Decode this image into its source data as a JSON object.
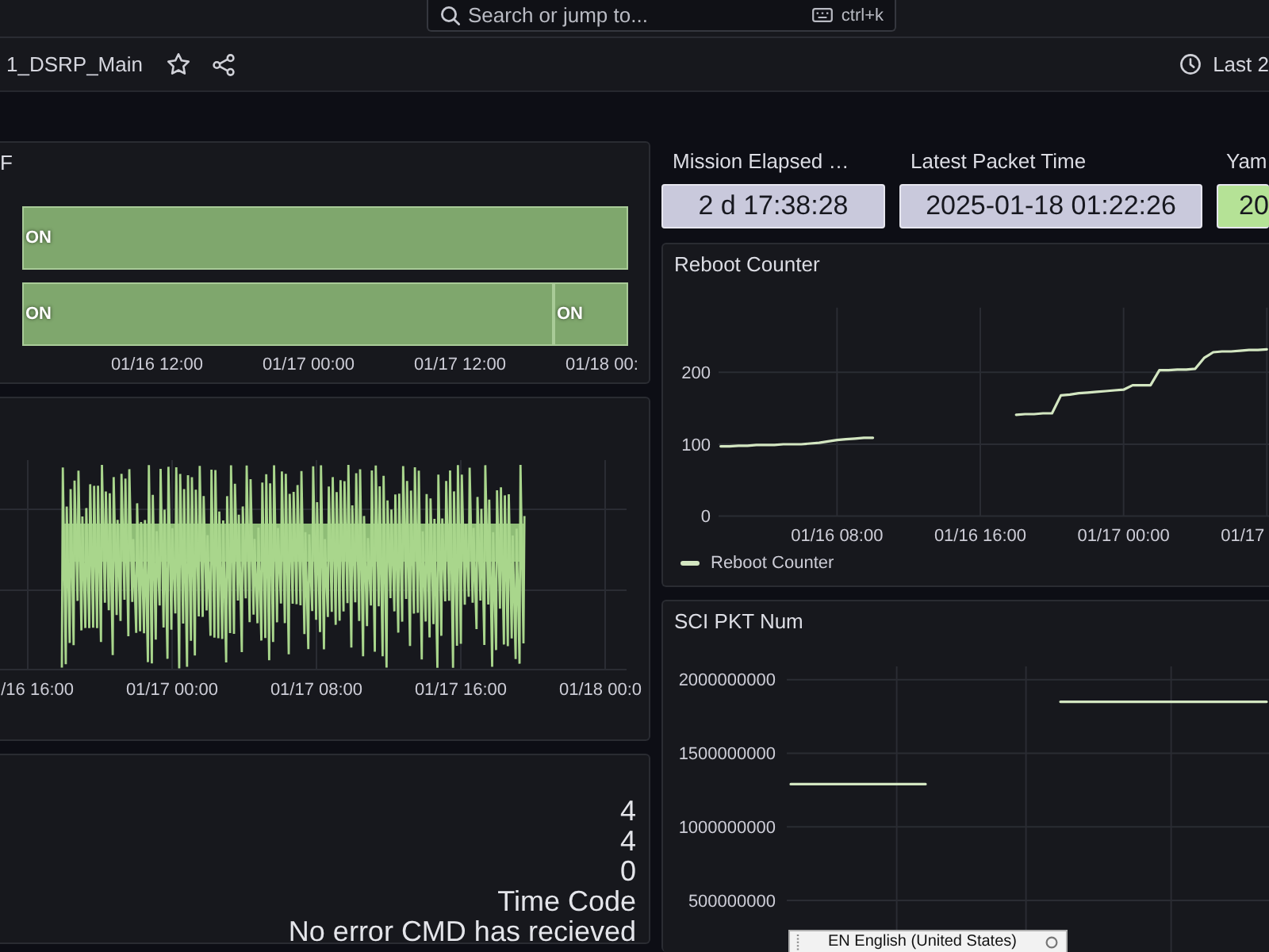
{
  "search": {
    "placeholder": "Search or jump to...",
    "shortcut": "ctrl+k"
  },
  "dashboard": {
    "title": "1_DSRP_Main",
    "starred": false,
    "time_range": "Last 2"
  },
  "state_panel": {
    "title": "F",
    "rows": [
      {
        "segments": [
          {
            "label": "ON"
          }
        ]
      },
      {
        "segments": [
          {
            "label": "ON"
          },
          {
            "label": "ON"
          }
        ],
        "level": 0.877
      }
    ],
    "x_labels": [
      "01/16 12:00",
      "01/17 00:00",
      "01/17 12:00",
      "01/18 00:"
    ]
  },
  "wave_panel": {
    "x_labels": [
      "/16 16:00",
      "01/17 00:00",
      "01/17 08:00",
      "01/17 16:00",
      "01/18 00:0"
    ]
  },
  "text_panel": {
    "lines": [
      "4",
      "4",
      "0",
      "Time Code",
      "No error CMD has recieved"
    ]
  },
  "stats": [
    {
      "title": "Mission Elapsed …",
      "value": "2 d 17:38:28",
      "color": "#c9c9dc"
    },
    {
      "title": "Latest Packet Time",
      "value": "2025-01-18 01:22:26",
      "color": "#c9c9dc"
    },
    {
      "title": "Yam",
      "value": "20",
      "color": "#b5e296"
    }
  ],
  "reboot_panel": {
    "title": "Reboot Counter",
    "legend": true,
    "partial_x_label": "01/17",
    "chart_data": {
      "type": "line",
      "grid": true,
      "categories": [
        null,
        null,
        null,
        null,
        null,
        null,
        null,
        null,
        null,
        null,
        null,
        null,
        null,
        "01/16 08:00",
        null,
        null,
        null,
        null,
        null,
        null,
        null,
        null,
        null,
        null,
        null,
        null,
        null,
        null,
        null,
        "01/16 16:00",
        null,
        null,
        null,
        null,
        null,
        null,
        null,
        null,
        null,
        null,
        null,
        null,
        null,
        null,
        null,
        "01/17 00:00",
        null,
        null,
        null,
        null,
        null,
        null,
        null,
        null,
        null,
        null,
        null,
        null,
        null,
        null,
        null,
        null
      ],
      "series": [
        {
          "name": "Reboot Counter",
          "color": "#d3e6c1",
          "values": [
            97,
            97,
            98,
            98,
            99,
            99,
            99,
            100,
            100,
            100,
            101,
            102,
            104,
            106,
            107,
            108,
            109,
            109,
            null,
            null,
            null,
            null,
            null,
            null,
            null,
            null,
            null,
            null,
            null,
            null,
            null,
            null,
            null,
            141,
            142,
            142,
            143,
            143,
            168,
            169,
            171,
            172,
            173,
            174,
            175,
            176,
            182,
            182,
            182,
            203,
            203,
            204,
            204,
            205,
            220,
            228,
            229,
            229,
            230,
            231,
            231,
            232
          ]
        }
      ],
      "ylim": [
        0,
        290
      ],
      "yticks": [
        0,
        100,
        200
      ]
    }
  },
  "sci_panel": {
    "title": "SCI PKT Num",
    "chart_data": {
      "type": "line",
      "grid": true,
      "categories": [
        null,
        null,
        null,
        null,
        null,
        null,
        null,
        null,
        null,
        null,
        null,
        null,
        null,
        null,
        null,
        null,
        null,
        null,
        null,
        null,
        null,
        null,
        null,
        null,
        null,
        null,
        null,
        null,
        null,
        null,
        null,
        null,
        null,
        null,
        null,
        null,
        null,
        null,
        null,
        null,
        null,
        null,
        null,
        null,
        null,
        null,
        null,
        null,
        null,
        null,
        null,
        null,
        null,
        null,
        null,
        null,
        null,
        null,
        null,
        null,
        null
      ],
      "series": [
        {
          "color": "#d3e6c1",
          "values": [
            1290000000,
            1290000000,
            1290000000,
            1290000000,
            1290000000,
            1290000000,
            1290000000,
            1290000000,
            1290000000,
            1290000000,
            1290000000,
            1290000000,
            1290000000,
            1290000000,
            1290000000,
            1290000000,
            1290000000,
            1290000000,
            null,
            null,
            null,
            null,
            null,
            null,
            null,
            null,
            null,
            null,
            null,
            null,
            null,
            null,
            null,
            null,
            1850000000,
            1850000000,
            1850000000,
            1850000000,
            1850000000,
            1850000000,
            1850000000,
            1850000000,
            1850000000,
            1850000000,
            1850000000,
            1850000000,
            1850000000,
            1850000000,
            1850000000,
            1850000000,
            1850000000,
            1850000000,
            1850000000,
            1850000000,
            1850000000,
            1850000000,
            1850000000,
            1850000000,
            1850000000,
            1850000000,
            1850000000
          ]
        }
      ],
      "ylim": [
        150000000,
        2090000000
      ],
      "yticks": [
        500000000,
        1000000000,
        1500000000,
        2000000000
      ]
    }
  },
  "language_popup": {
    "text": "EN English (United States)"
  }
}
